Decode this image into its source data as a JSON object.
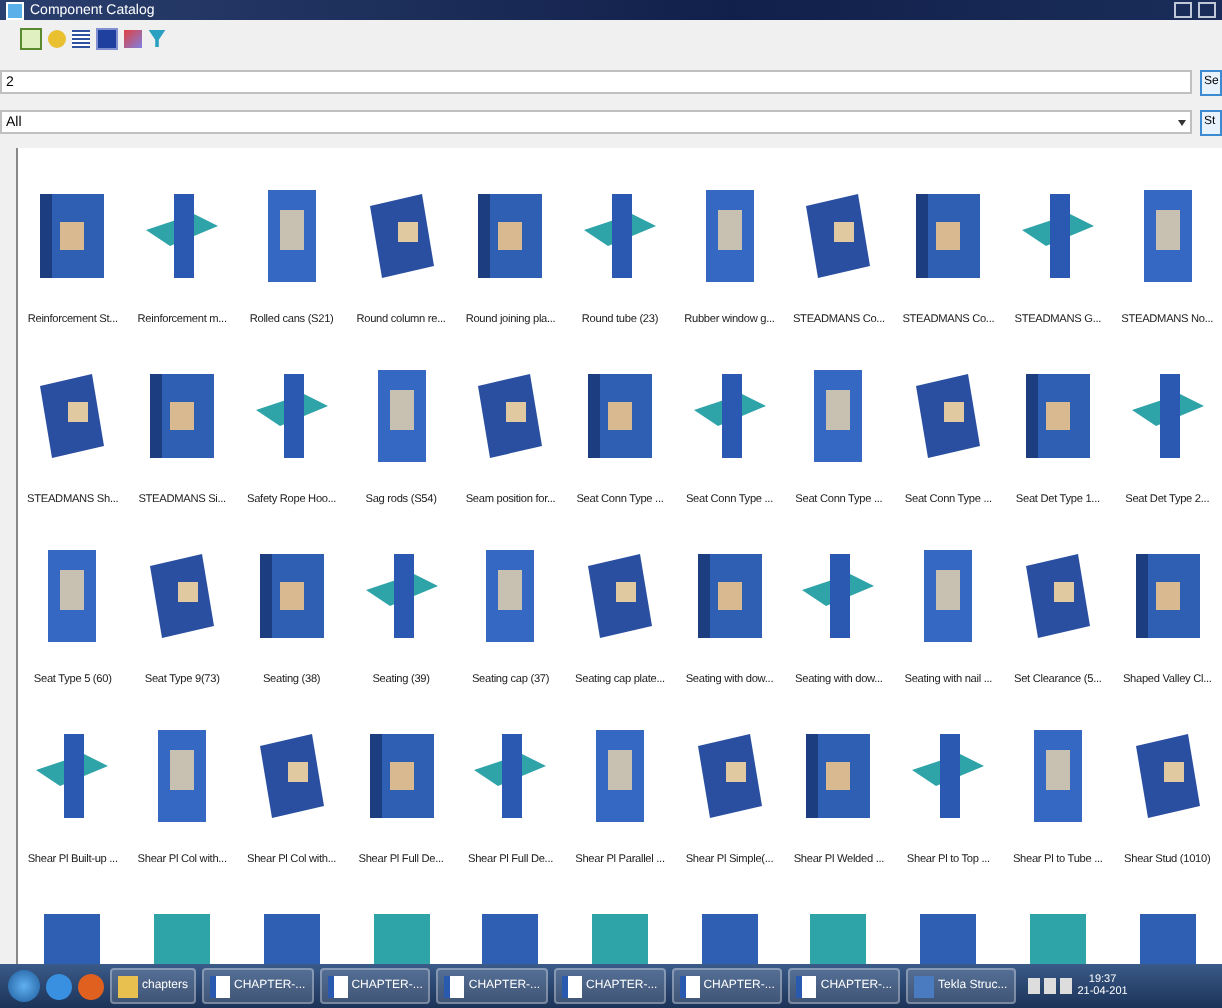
{
  "window": {
    "title": "Component Catalog"
  },
  "search": {
    "value": "2",
    "button": "Se"
  },
  "filter": {
    "value": "All",
    "button": "St"
  },
  "components": [
    {
      "label": "Reinforcement St..."
    },
    {
      "label": "Reinforcement m..."
    },
    {
      "label": "Rolled cans (S21)"
    },
    {
      "label": "Round column re..."
    },
    {
      "label": "Round joining pla..."
    },
    {
      "label": "Round tube (23)"
    },
    {
      "label": "Rubber window g..."
    },
    {
      "label": "STEADMANS Co..."
    },
    {
      "label": "STEADMANS Co..."
    },
    {
      "label": "STEADMANS G..."
    },
    {
      "label": "STEADMANS No..."
    },
    {
      "label": "STEADMANS Sh..."
    },
    {
      "label": "STEADMANS Si..."
    },
    {
      "label": "Safety Rope Hoo..."
    },
    {
      "label": "Sag rods (S54)"
    },
    {
      "label": "Seam position for..."
    },
    {
      "label": "Seat Conn Type ..."
    },
    {
      "label": "Seat Conn Type ..."
    },
    {
      "label": "Seat Conn Type ..."
    },
    {
      "label": "Seat Conn Type ..."
    },
    {
      "label": "Seat Det Type 1..."
    },
    {
      "label": "Seat Det Type 2..."
    },
    {
      "label": "Seat Type 5 (60)"
    },
    {
      "label": "Seat Type 9(73)"
    },
    {
      "label": "Seating (38)"
    },
    {
      "label": "Seating (39)"
    },
    {
      "label": "Seating cap (37)"
    },
    {
      "label": "Seating cap plate..."
    },
    {
      "label": "Seating with dow..."
    },
    {
      "label": "Seating with dow..."
    },
    {
      "label": "Seating with nail ..."
    },
    {
      "label": "Set Clearance (5..."
    },
    {
      "label": "Shaped Valley Cl..."
    },
    {
      "label": "Shear Pl Built-up ..."
    },
    {
      "label": "Shear Pl Col with..."
    },
    {
      "label": "Shear Pl Col with..."
    },
    {
      "label": "Shear Pl Full De..."
    },
    {
      "label": "Shear Pl Full De..."
    },
    {
      "label": "Shear Pl Parallel ..."
    },
    {
      "label": "Shear Pl Simple(..."
    },
    {
      "label": "Shear Pl Welded ..."
    },
    {
      "label": "Shear Pl to Top ..."
    },
    {
      "label": "Shear Pl to Tube ..."
    },
    {
      "label": "Shear Stud (1010)"
    }
  ],
  "taskbar": {
    "buttons": [
      {
        "kind": "folder",
        "label": "chapters"
      },
      {
        "kind": "word",
        "label": "CHAPTER-..."
      },
      {
        "kind": "word",
        "label": "CHAPTER-..."
      },
      {
        "kind": "word",
        "label": "CHAPTER-..."
      },
      {
        "kind": "word",
        "label": "CHAPTER-..."
      },
      {
        "kind": "word",
        "label": "CHAPTER-..."
      },
      {
        "kind": "word",
        "label": "CHAPTER-..."
      },
      {
        "kind": "app",
        "label": "Tekla Struc..."
      }
    ],
    "time": "19:37",
    "date": "21-04-201"
  }
}
